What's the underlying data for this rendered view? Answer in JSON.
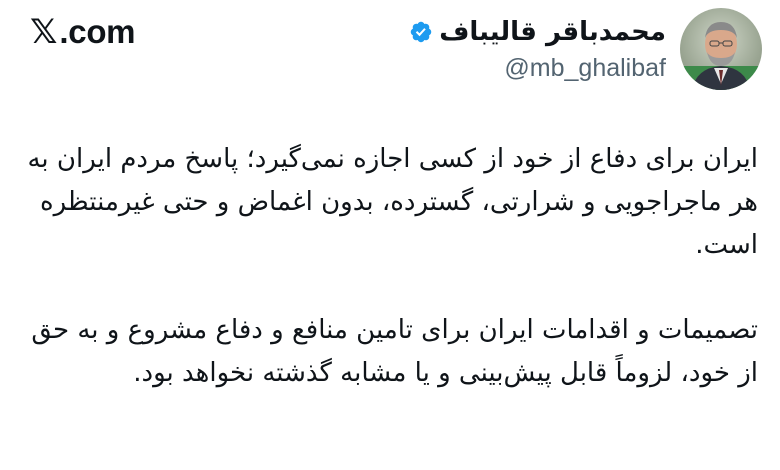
{
  "brand": {
    "logo_glyph": "𝕏",
    "site": ".com"
  },
  "author": {
    "name": "محمدباقر قالیباف",
    "handle": "@mb_ghalibaf",
    "verified_icon": "verified-badge-icon",
    "verified_color": "#1d9bf0"
  },
  "tweet": {
    "paragraphs": [
      "ایران برای دفاع از خود از کسی اجازه نمی‌گیرد؛ پاسخ مردم ایران به هر ماجراجویی و شرارتی، گسترده، بدون اغماض و حتی غیرمنتظره است.",
      "تصمیمات و اقدامات ایران برای تامین منافع و دفاع مشروع و به حق از خود، لزوماً قابل پیش‌بینی و یا مشابه گذشته نخواهد بود."
    ]
  },
  "colors": {
    "text": "#0f1419",
    "secondary_text": "#536471",
    "background": "#ffffff"
  }
}
